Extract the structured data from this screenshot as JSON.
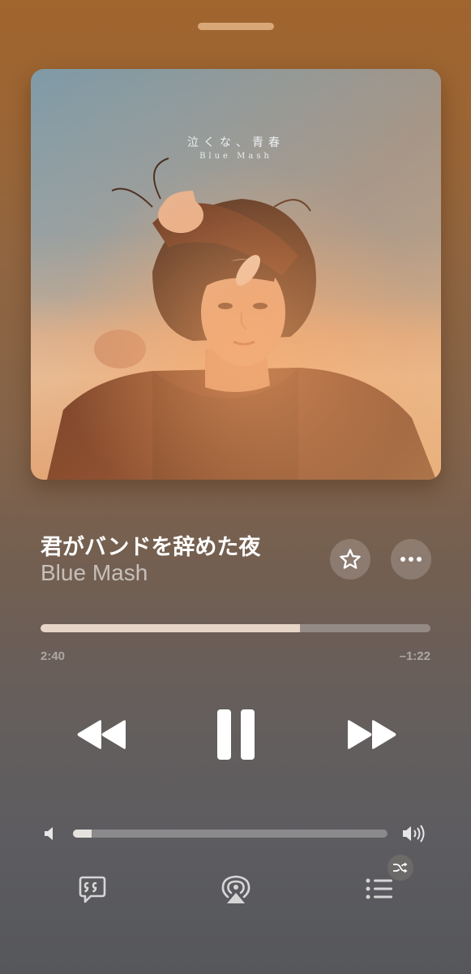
{
  "colors": {
    "background_top": "#a1652e",
    "background_bottom": "#56575a",
    "progress_fill": "#e7d6c7",
    "volume_fill": "#e6e2de",
    "grabber": "#d9a678"
  },
  "artwork": {
    "title_text": "泣くな、青春",
    "artist_text": "Blue Mash",
    "description": "album-cover-photo"
  },
  "now_playing": {
    "title": "君がバンドを辞めた夜",
    "artist": "Blue Mash",
    "favorite_icon": "star-icon",
    "more_icon": "ellipsis-icon"
  },
  "progress": {
    "elapsed": "2:40",
    "remaining": "–1:22",
    "fraction": 0.665
  },
  "controls": {
    "rewind_icon": "rewind-icon",
    "pause_icon": "pause-icon",
    "forward_icon": "fast-forward-icon"
  },
  "volume": {
    "level": 0.06,
    "low_icon": "speaker-low-icon",
    "high_icon": "speaker-high-icon"
  },
  "bottom_bar": {
    "lyrics_icon": "lyrics-quote-icon",
    "airplay_icon": "airplay-icon",
    "queue_icon": "queue-list-icon",
    "shuffle_badge_icon": "shuffle-icon"
  }
}
